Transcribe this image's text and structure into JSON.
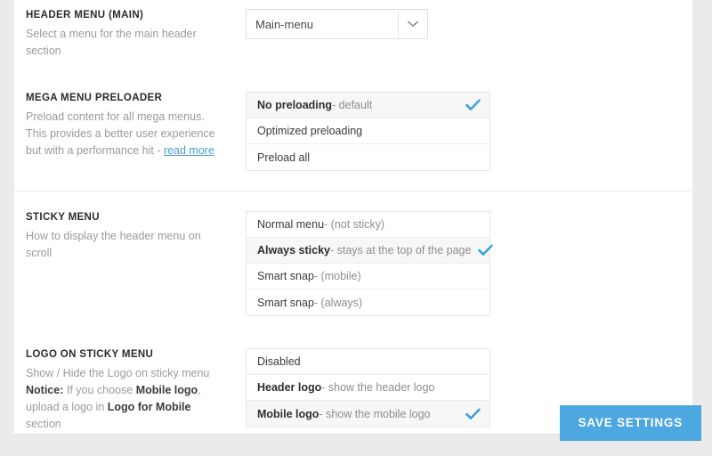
{
  "theme": {
    "accent": "#4da7e0",
    "check_color": "#3ba3d8",
    "link_color": "#4a9cc4",
    "page_bg": "#ebebeb",
    "panel_bg": "#ffffff"
  },
  "groups": [
    {
      "id": "group-menu",
      "settings": [
        {
          "id": "header-menu-main",
          "title": "HEADER MENU (MAIN)",
          "desc_parts": [
            {
              "text": "Select a menu for the main header section",
              "style": "normal"
            }
          ],
          "control": "select",
          "select": {
            "value": "Main-menu",
            "icon": "chevron-down-icon"
          }
        },
        {
          "id": "mega-menu-preloader",
          "title": "MEGA MENU PRELOADER",
          "desc_parts": [
            {
              "text": "Preload content for all mega menus. This provides a better user experience but with a performance hit - ",
              "style": "normal"
            },
            {
              "text": "read more",
              "style": "link"
            }
          ],
          "control": "option-list",
          "options": [
            {
              "main": "No preloading",
              "sub": " - default",
              "selected": true
            },
            {
              "main": "Optimized preloading",
              "sub": "",
              "selected": false
            },
            {
              "main": "Preload all",
              "sub": "",
              "selected": false
            }
          ]
        }
      ]
    },
    {
      "id": "group-sticky",
      "settings": [
        {
          "id": "sticky-menu",
          "title": "STICKY MENU",
          "desc_parts": [
            {
              "text": "How to display the header menu on scroll",
              "style": "normal"
            }
          ],
          "control": "option-list",
          "options": [
            {
              "main": "Normal menu",
              "sub": " - (not sticky)",
              "selected": false
            },
            {
              "main": "Always sticky",
              "sub": " - stays at the top of the page",
              "selected": true
            },
            {
              "main": "Smart snap",
              "sub": " - (mobile)",
              "selected": false
            },
            {
              "main": "Smart snap",
              "sub": " - (always)",
              "selected": false
            }
          ]
        },
        {
          "id": "logo-on-sticky-menu",
          "title": "LOGO ON STICKY MENU",
          "desc_parts": [
            {
              "text": "Show / Hide the Logo on sticky menu",
              "style": "normal"
            },
            {
              "text": "\n",
              "style": "break"
            },
            {
              "text": "Notice:",
              "style": "bold"
            },
            {
              "text": " If you choose ",
              "style": "normal"
            },
            {
              "text": "Mobile logo",
              "style": "bold"
            },
            {
              "text": ", upload a logo in ",
              "style": "normal"
            },
            {
              "text": "Logo for Mobile",
              "style": "bold"
            },
            {
              "text": " section",
              "style": "normal"
            }
          ],
          "control": "option-list",
          "options": [
            {
              "main": "Disabled",
              "sub": "",
              "selected": false
            },
            {
              "main": "Header logo",
              "sub": " - show the header logo",
              "selected": false,
              "bold_main": true
            },
            {
              "main": "Mobile logo",
              "sub": " - show the mobile logo",
              "selected": true,
              "bold_main": true
            }
          ]
        }
      ]
    }
  ],
  "footer": {
    "save_label": "SAVE SETTINGS"
  }
}
